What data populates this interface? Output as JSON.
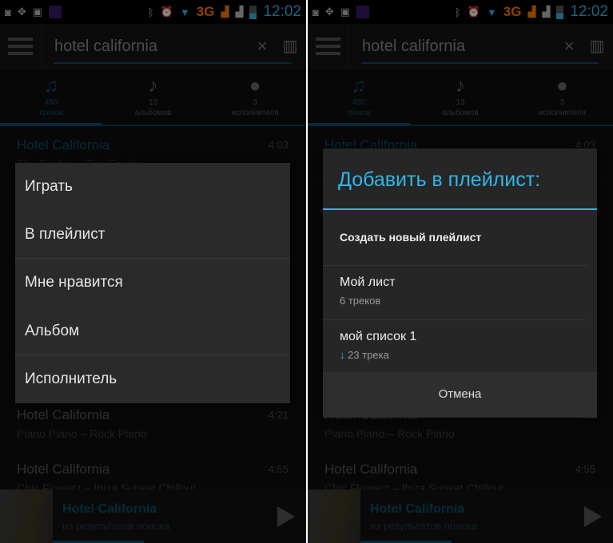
{
  "status_bar": {
    "network": "3G",
    "time": "12:02"
  },
  "search": {
    "query": "hotel california",
    "clear_icon": "close-icon",
    "voice_icon": "equalizer-icon"
  },
  "tabs": [
    {
      "count": "480",
      "label": "треков",
      "icon": "music-notes-icon",
      "active": true
    },
    {
      "count": "13",
      "label": "альбомов",
      "icon": "music-note-icon"
    },
    {
      "count": "3",
      "label": "исполнителя",
      "icon": "person-icon"
    }
  ],
  "tracks": [
    {
      "title": "Hotel California",
      "artist": "The Eagles – The Eagles",
      "duration": "4:03"
    },
    {
      "title": "Hotel California",
      "artist": "Piano Piano – Rock Piano",
      "duration": "4:21"
    },
    {
      "title": "Hotel California",
      "artist": "Chic Flowerz – Ibiza Sunset Chillout",
      "duration": "4:55"
    }
  ],
  "now_playing": {
    "title": "Hotel California",
    "subtitle": "из результатов поиска",
    "progress": 0.36
  },
  "context_menu": {
    "items": [
      "Играть",
      "В плейлист",
      "Мне нравится",
      "Альбом",
      "Исполнитель"
    ]
  },
  "playlist_dialog": {
    "title": "Добавить в плейлист:",
    "create_label": "Создать новый плейлист",
    "playlists": [
      {
        "name": "Мой лист",
        "count": "6 треков"
      },
      {
        "name": "мой список 1",
        "count": "23 трека",
        "downloaded": true
      }
    ],
    "cancel_label": "Отмена"
  },
  "colors": {
    "accent": "#33b5e5",
    "network": "#ff7a00"
  }
}
